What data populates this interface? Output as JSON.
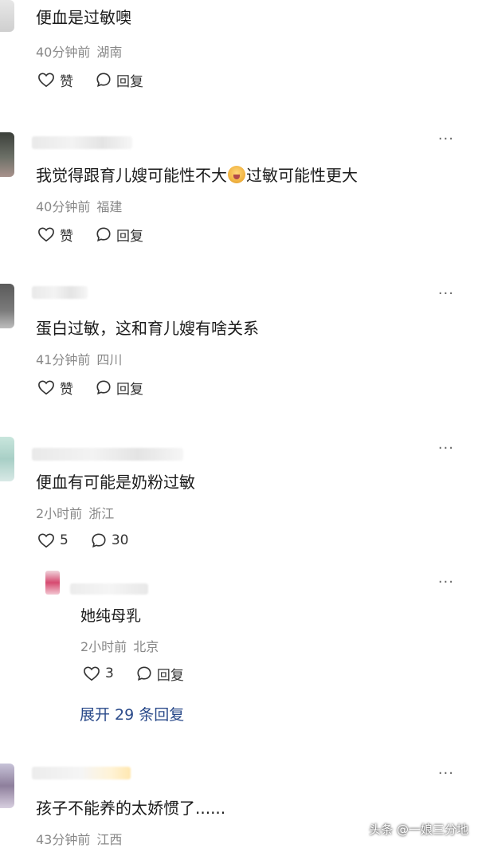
{
  "comments": [
    {
      "text": "便血是过敏噢",
      "time": "40分钟前",
      "location": "湖南",
      "like_label": "赞",
      "reply_label": "回复"
    },
    {
      "text_before": "我觉得跟育儿嫂可能性不大",
      "text_after": "过敏可能性更大",
      "emoji": "crying-face-emoji",
      "time": "40分钟前",
      "location": "福建",
      "like_label": "赞",
      "reply_label": "回复"
    },
    {
      "text": "蛋白过敏，这和育儿嫂有啥关系",
      "time": "41分钟前",
      "location": "四川",
      "like_label": "赞",
      "reply_label": "回复"
    },
    {
      "text": "便血有可能是奶粉过敏",
      "time": "2小时前",
      "location": "浙江",
      "like_count": "5",
      "reply_count": "30",
      "reply": {
        "text": "她纯母乳",
        "time": "2小时前",
        "location": "北京",
        "like_count": "3",
        "reply_label": "回复"
      },
      "expand_label": "展开 29 条回复"
    },
    {
      "text": "孩子不能养的太娇惯了......",
      "time": "43分钟前",
      "location": "江西"
    }
  ],
  "more_label": "···",
  "watermark": "头条 @一娘三分地",
  "icons": {
    "like": "heart-outline-icon",
    "reply": "speech-bubble-icon",
    "more": "more-dots-icon"
  }
}
